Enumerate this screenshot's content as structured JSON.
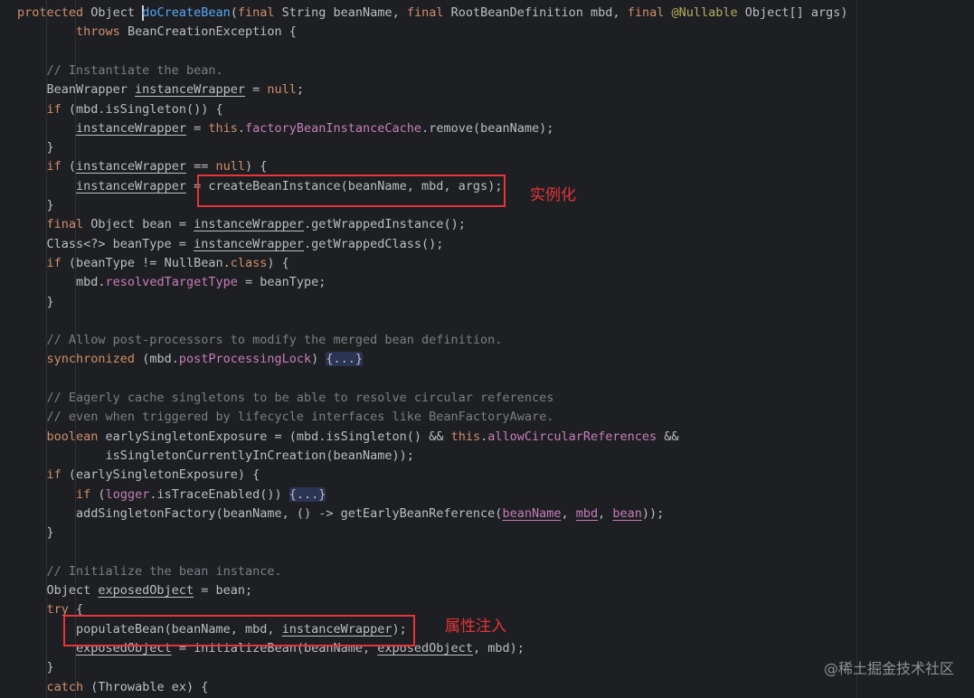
{
  "editor": {
    "lines": [
      [
        [
          "protected ",
          "kw"
        ],
        [
          "Object ",
          ""
        ],
        [
          "CARET",
          "caret"
        ],
        [
          "doCreateBean",
          "fn"
        ],
        [
          "(",
          ""
        ],
        [
          "final ",
          "kw"
        ],
        [
          "String beanName, ",
          ""
        ],
        [
          "final ",
          "kw"
        ],
        [
          "RootBeanDefinition mbd, ",
          ""
        ],
        [
          "final ",
          "kw"
        ],
        [
          "@Nullable ",
          "ann"
        ],
        [
          "Object[] args)",
          ""
        ]
      ],
      [
        [
          "        ",
          ""
        ],
        [
          "throws ",
          "kw"
        ],
        [
          "BeanCreationException {",
          ""
        ]
      ],
      [],
      [
        [
          "    ",
          ""
        ],
        [
          "// Instantiate the bean.",
          "cmt"
        ]
      ],
      [
        [
          "    BeanWrapper ",
          ""
        ],
        [
          "instanceWrapper",
          "ul"
        ],
        [
          " = ",
          ""
        ],
        [
          "null",
          "kw"
        ],
        [
          ";",
          ""
        ]
      ],
      [
        [
          "    ",
          ""
        ],
        [
          "if ",
          "kw"
        ],
        [
          "(mbd.isSingleton()) {",
          ""
        ]
      ],
      [
        [
          "        ",
          ""
        ],
        [
          "instanceWrapper",
          "ul"
        ],
        [
          " = ",
          ""
        ],
        [
          "this",
          "kw"
        ],
        [
          ".",
          ""
        ],
        [
          "factoryBeanInstanceCache",
          "field"
        ],
        [
          ".remove(beanName);",
          ""
        ]
      ],
      [
        [
          "    }",
          ""
        ]
      ],
      [
        [
          "    ",
          ""
        ],
        [
          "if ",
          "kw"
        ],
        [
          "(",
          ""
        ],
        [
          "instanceWrapper",
          "ul"
        ],
        [
          " == ",
          ""
        ],
        [
          "null",
          "kw"
        ],
        [
          ") {",
          ""
        ]
      ],
      [
        [
          "        ",
          ""
        ],
        [
          "instanceWrapper",
          "ul"
        ],
        [
          " = createBeanInstance(beanName, mbd, args);",
          ""
        ]
      ],
      [
        [
          "    }",
          ""
        ]
      ],
      [
        [
          "    ",
          ""
        ],
        [
          "final ",
          "kw"
        ],
        [
          "Object bean = ",
          ""
        ],
        [
          "instanceWrapper",
          "ul"
        ],
        [
          ".getWrappedInstance();",
          ""
        ]
      ],
      [
        [
          "    Class<?> beanType = ",
          ""
        ],
        [
          "instanceWrapper",
          "ul"
        ],
        [
          ".getWrappedClass();",
          ""
        ]
      ],
      [
        [
          "    ",
          ""
        ],
        [
          "if ",
          "kw"
        ],
        [
          "(beanType != NullBean.",
          ""
        ],
        [
          "class",
          "kw"
        ],
        [
          ") {",
          ""
        ]
      ],
      [
        [
          "        mbd.",
          ""
        ],
        [
          "resolvedTargetType",
          "field"
        ],
        [
          " = beanType;",
          ""
        ]
      ],
      [
        [
          "    }",
          ""
        ]
      ],
      [],
      [
        [
          "    ",
          ""
        ],
        [
          "// Allow post-processors to modify the merged bean definition.",
          "cmt"
        ]
      ],
      [
        [
          "    ",
          ""
        ],
        [
          "synchronized ",
          "kw"
        ],
        [
          "(mbd.",
          ""
        ],
        [
          "postProcessingLock",
          "field"
        ],
        [
          ") ",
          ""
        ],
        [
          "{...}",
          "fold"
        ]
      ],
      [],
      [
        [
          "    ",
          ""
        ],
        [
          "// Eagerly cache singletons to be able to resolve circular references",
          "cmt"
        ]
      ],
      [
        [
          "    ",
          ""
        ],
        [
          "// even when triggered by lifecycle interfaces like BeanFactoryAware.",
          "cmt"
        ]
      ],
      [
        [
          "    ",
          ""
        ],
        [
          "boolean ",
          "kw"
        ],
        [
          "earlySingletonExposure = (mbd.isSingleton() && ",
          ""
        ],
        [
          "this",
          "kw"
        ],
        [
          ".",
          ""
        ],
        [
          "allowCircularReferences",
          "field"
        ],
        [
          " &&",
          ""
        ]
      ],
      [
        [
          "            isSingletonCurrentlyInCreation(beanName));",
          ""
        ]
      ],
      [
        [
          "    ",
          ""
        ],
        [
          "if ",
          "kw"
        ],
        [
          "(earlySingletonExposure) {",
          ""
        ]
      ],
      [
        [
          "        ",
          ""
        ],
        [
          "if ",
          "kw"
        ],
        [
          "(",
          ""
        ],
        [
          "logger",
          "field"
        ],
        [
          ".isTraceEnabled()) ",
          ""
        ],
        [
          "{...}",
          "fold"
        ]
      ],
      [
        [
          "        addSingletonFactory(beanName, () -> getEarlyBeanReference(",
          ""
        ],
        [
          "beanName",
          "param-ul"
        ],
        [
          ", ",
          ""
        ],
        [
          "mbd",
          "param-ul"
        ],
        [
          ", ",
          ""
        ],
        [
          "bean",
          "param-ul"
        ],
        [
          "));",
          ""
        ]
      ],
      [
        [
          "    }",
          ""
        ]
      ],
      [],
      [
        [
          "    ",
          ""
        ],
        [
          "// Initialize the bean instance.",
          "cmt"
        ]
      ],
      [
        [
          "    Object ",
          ""
        ],
        [
          "exposedObject",
          "ul"
        ],
        [
          " = bean;",
          ""
        ]
      ],
      [
        [
          "    ",
          ""
        ],
        [
          "try ",
          "kw"
        ],
        [
          "{",
          ""
        ]
      ],
      [
        [
          "        populateBean(beanName, mbd, ",
          ""
        ],
        [
          "instanceWrapper",
          "ul"
        ],
        [
          ");",
          ""
        ]
      ],
      [
        [
          "        ",
          ""
        ],
        [
          "exposedObject",
          "ul"
        ],
        [
          " = initializeBean(beanName, ",
          ""
        ],
        [
          "exposedObject",
          "ul"
        ],
        [
          ", mbd);",
          ""
        ]
      ],
      [
        [
          "    }",
          ""
        ]
      ],
      [
        [
          "    ",
          ""
        ],
        [
          "catch ",
          "kw"
        ],
        [
          "(Throwable ex) {",
          ""
        ]
      ]
    ]
  },
  "annotations": {
    "instantiation_label": "实例化",
    "populate_label": "属性注入"
  },
  "watermark": "@稀土掘金技术社区",
  "colors": {
    "background": "#1e1f22",
    "keyword": "#cf8e6d",
    "method": "#56a8f5",
    "field": "#c77dbb",
    "comment": "#7a7e85",
    "annotation_box": "#e8333a"
  }
}
